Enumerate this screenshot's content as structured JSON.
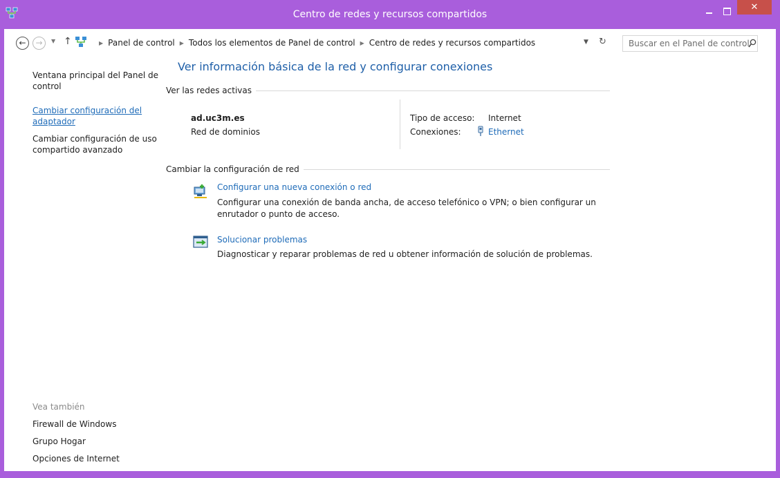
{
  "window": {
    "title": "Centro de redes y recursos compartidos",
    "close_glyph": "✕",
    "accent_color": "#a95edc",
    "close_color": "#c7504a"
  },
  "address": {
    "back_glyph": "←",
    "forward_glyph": "→",
    "recent_glyph": "▼",
    "up_glyph": "↑",
    "crumbs": [
      "Panel de control",
      "Todos los elementos de Panel de control",
      "Centro de redes y recursos compartidos"
    ],
    "crumb_sep": "▶",
    "dropdown_glyph": "▼",
    "refresh_glyph": "↻",
    "search_placeholder": "Buscar en el Panel de control"
  },
  "sidebar": {
    "home_link": "Ventana principal del Panel de control",
    "adapter_link": "Cambiar configuración del adaptador",
    "sharing_link": "Cambiar configuración de uso compartido avanzado",
    "see_also_label": "Vea también",
    "see_also": [
      "Firewall de Windows",
      "Grupo Hogar",
      "Opciones de Internet"
    ]
  },
  "main": {
    "title": "Ver información básica de la red y configurar conexiones",
    "active_networks_label": "Ver las redes activas",
    "network": {
      "name": "ad.uc3m.es",
      "type": "Red de dominios",
      "access_label": "Tipo de acceso:",
      "access_value": "Internet",
      "connections_label": "Conexiones:",
      "connections_value": "Ethernet"
    },
    "change_settings_label": "Cambiar la configuración de red",
    "tasks": [
      {
        "title": "Configurar una nueva conexión o red",
        "description": "Configurar una conexión de banda ancha, de acceso telefónico o VPN; o bien configurar un enrutador o punto de acceso.",
        "icon": "new-connection-icon"
      },
      {
        "title": "Solucionar problemas",
        "description": "Diagnosticar y reparar problemas de red u obtener información de solución de problemas.",
        "icon": "troubleshoot-icon"
      }
    ]
  }
}
